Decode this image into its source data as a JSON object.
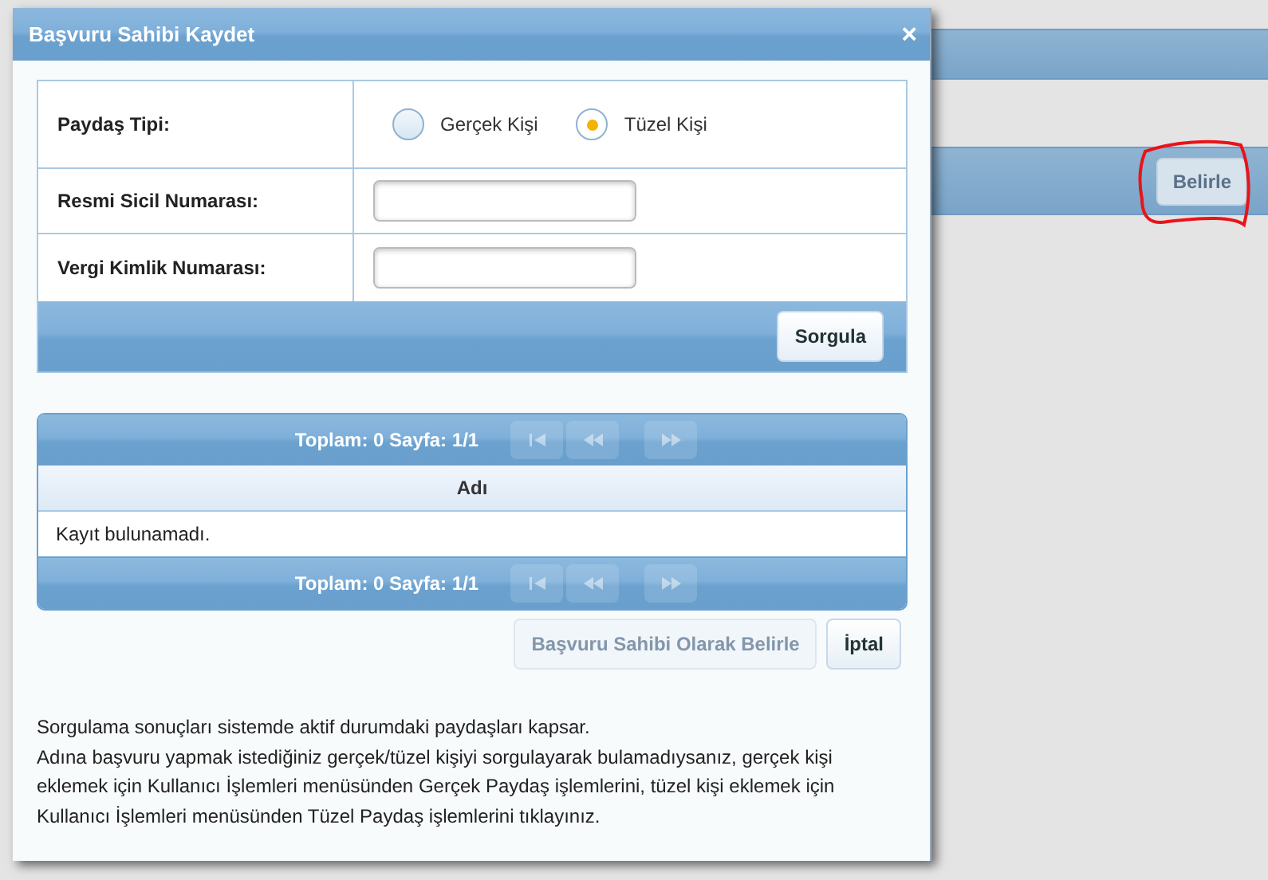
{
  "background": {
    "buttons": [
      {
        "label": "Belirle"
      }
    ]
  },
  "dialog": {
    "title": "Başvuru Sahibi Kaydet",
    "close": "×",
    "form": {
      "type_label": "Paydaş Tipi:",
      "options": [
        {
          "label": "Gerçek Kişi",
          "selected": false
        },
        {
          "label": "Tüzel Kişi",
          "selected": true
        }
      ],
      "fields": [
        {
          "label": "Resmi Sicil Numarası:"
        },
        {
          "label": "Vergi Kimlik Numarası:"
        }
      ],
      "search_button": "Sorgula"
    },
    "grid": {
      "pager_top": "Toplam: 0 Sayfa: 1/1",
      "pager_bottom": "Toplam: 0 Sayfa: 1/1",
      "pager_buttons": [
        {
          "kind": "first",
          "disabled": true
        },
        {
          "kind": "prev",
          "disabled": true
        },
        {
          "kind": "next",
          "disabled": true
        }
      ],
      "columns": [
        "Adı"
      ],
      "empty_text": "Kayıt bulunamadı."
    },
    "buttons": [
      {
        "label": "Başvuru Sahibi Olarak Belirle",
        "disabled": true
      },
      {
        "label": "İptal",
        "disabled": false
      }
    ],
    "notes": [
      "Sorgulama sonuçları sistemde aktif durumdaki paydaşları kapsar.",
      "Adına başvuru yapmak istediğiniz gerçek/tüzel kişiyi sorgulayarak bulamadıysanız, gerçek kişi eklemek için Kullanıcı İşlemleri menüsünden Gerçek Paydaş işlemlerini, tüzel kişi eklemek için Kullanıcı İşlemleri menüsünden Tüzel Paydaş işlemlerini tıklayınız."
    ]
  }
}
